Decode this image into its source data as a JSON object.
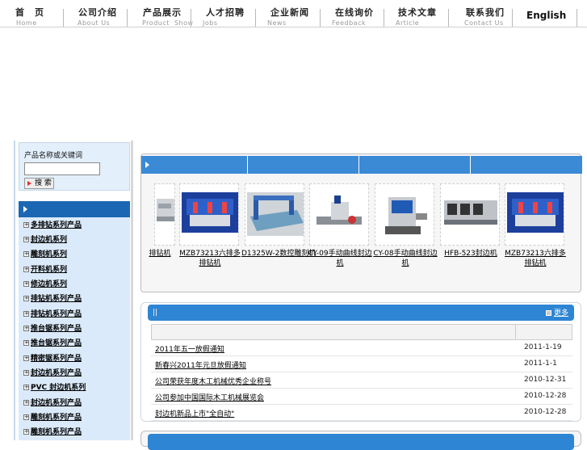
{
  "nav": {
    "items": [
      {
        "cn": "首　页",
        "en": "Home"
      },
      {
        "cn": "公司介绍",
        "en": "About Us"
      },
      {
        "cn": "产品展示",
        "en": "Product  Show"
      },
      {
        "cn": "人才招聘",
        "en": "Jobs"
      },
      {
        "cn": "企业新闻",
        "en": "News"
      },
      {
        "cn": "在线询价",
        "en": "Feedback"
      },
      {
        "cn": "技术文章",
        "en": "Article"
      },
      {
        "cn": "联系我们",
        "en": "Contact Us"
      }
    ],
    "english": "English"
  },
  "search": {
    "title": "产品名称或关键词",
    "value": "",
    "button": "搜 索"
  },
  "categories": [
    "多排钻系列产品",
    "封边机系列",
    "雕刻机系列",
    "开料机系列",
    "修边机系列",
    "排钻机系列产品",
    "排钻机系列产品",
    "推台锯系列产品",
    "推台锯系列产品",
    "精密锯系列产品",
    "封边机系列产品",
    "PVC 封边机系列",
    "封边机系列产品",
    "雕刻机系列产品",
    "雕刻机系列产品"
  ],
  "products": {
    "items": [
      {
        "caption": "排钻机"
      },
      {
        "caption": "MZB73213六排多排钻机"
      },
      {
        "caption": "D1325W-2数控雕刻机"
      },
      {
        "caption": "CY-09手动曲线封边机"
      },
      {
        "caption": "CY-08手动曲线封边机"
      },
      {
        "caption": "HFB-523封边机"
      },
      {
        "caption": "MZB73213六排多排钻机"
      }
    ]
  },
  "news": {
    "more": "更多",
    "rows": [
      {
        "title": "2011年五一放假通知",
        "date": "2011-1-19"
      },
      {
        "title": "新春兴2011年元旦放假通知",
        "date": "2011-1-1"
      },
      {
        "title": "公司荣获年度木工机械优秀企业称号",
        "date": "2010-12-31"
      },
      {
        "title": "公司参加中国国际木工机械展览会",
        "date": "2010-12-28"
      },
      {
        "title": "封边机新品上市\"全自动\"",
        "date": "2010-12-28"
      }
    ]
  },
  "colors": {
    "bar_blue": "#3a8ad6",
    "header_blue": "#1b67b4",
    "side_bg": "#dbeafa"
  }
}
